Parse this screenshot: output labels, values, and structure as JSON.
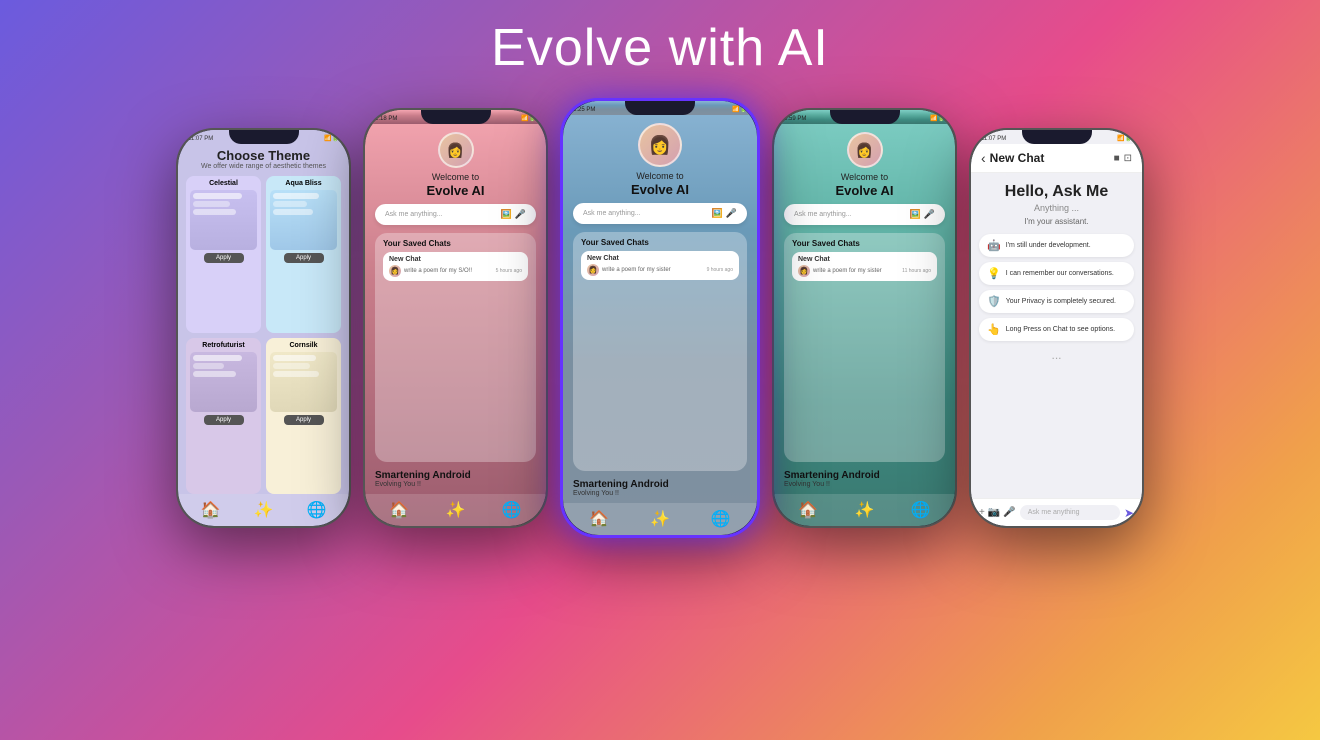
{
  "header": {
    "title": "Evolve with AI"
  },
  "phone1": {
    "status_time": "11:07 PM",
    "screen_title": "Choose Theme",
    "screen_subtitle": "We offer wide range of aesthetic themes",
    "themes": [
      {
        "name": "Celestial",
        "class": "celestial",
        "preview_class": "preview-celestial",
        "apply_label": "Apply"
      },
      {
        "name": "Aqua Bliss",
        "class": "aqua-bliss",
        "preview_class": "preview-aqua",
        "apply_label": "Apply"
      },
      {
        "name": "Retrofuturist",
        "class": "retrofuturist",
        "preview_class": "preview-retro",
        "apply_label": "Apply"
      },
      {
        "name": "Cornsilk",
        "class": "cornsilk",
        "preview_class": "preview-cornsilk",
        "apply_label": "Apply"
      }
    ],
    "bottom_icons": [
      "🏠",
      "✨",
      "🌐"
    ]
  },
  "phone2": {
    "status_time": "1:18 PM",
    "welcome": "Welcome to",
    "app_name": "Evolve AI",
    "search_placeholder": "Ask me anything...",
    "saved_chats_title": "Your Saved Chats",
    "new_chat_label": "New Chat",
    "chat_preview": "write a poem for my S/O!!",
    "chat_time": "5 hours ago",
    "smartening_title": "Smartening Android",
    "smartening_sub": "Evolving You !!",
    "bottom_icons": [
      "🏠",
      "✨",
      "🌐"
    ]
  },
  "phone3": {
    "status_time": "1:25 PM",
    "welcome": "Welcome to",
    "app_name": "Evolve AI",
    "search_placeholder": "Ask me anything...",
    "saved_chats_title": "Your Saved Chats",
    "new_chat_label": "New Chat",
    "chat_preview": "write a poem for my sister",
    "chat_time": "9 hours ago",
    "smartening_title": "Smartening Android",
    "smartening_sub": "Evolving You !!",
    "bottom_icons": [
      "🏠",
      "✨",
      "🌐"
    ]
  },
  "phone4": {
    "status_time": "3:59 PM",
    "welcome": "Welcome to",
    "app_name": "Evolve AI",
    "search_placeholder": "Ask me anything...",
    "saved_chats_title": "Your Saved Chats",
    "new_chat_label": "New Chat",
    "chat_preview": "write a poem for my sister",
    "chat_time": "11 hours ago",
    "smartening_title": "Smartening Android",
    "smartening_sub": "Evolving You !!",
    "bottom_icons": [
      "🏠",
      "✨",
      "🌐"
    ]
  },
  "phone5": {
    "status_time": "11:07 PM",
    "header_back": "‹",
    "header_title": "New Chat",
    "header_icons": [
      "■",
      "⊡"
    ],
    "hello": "Hello, Ask Me",
    "anything": "Anything ...",
    "assistant": "I'm your assistant.",
    "bubbles": [
      {
        "emoji": "🤖",
        "text": "I'm still under development."
      },
      {
        "emoji": "💡",
        "text": "I can remember our conversations."
      },
      {
        "emoji": "🛡️",
        "text": "Your Privacy is completely secured."
      },
      {
        "emoji": "👆",
        "text": "Long Press on Chat to see options."
      }
    ],
    "more": "...",
    "input_icons": [
      "+",
      "📷",
      "🎤"
    ],
    "input_placeholder": "Ask me anything",
    "send_icon": "➤"
  }
}
